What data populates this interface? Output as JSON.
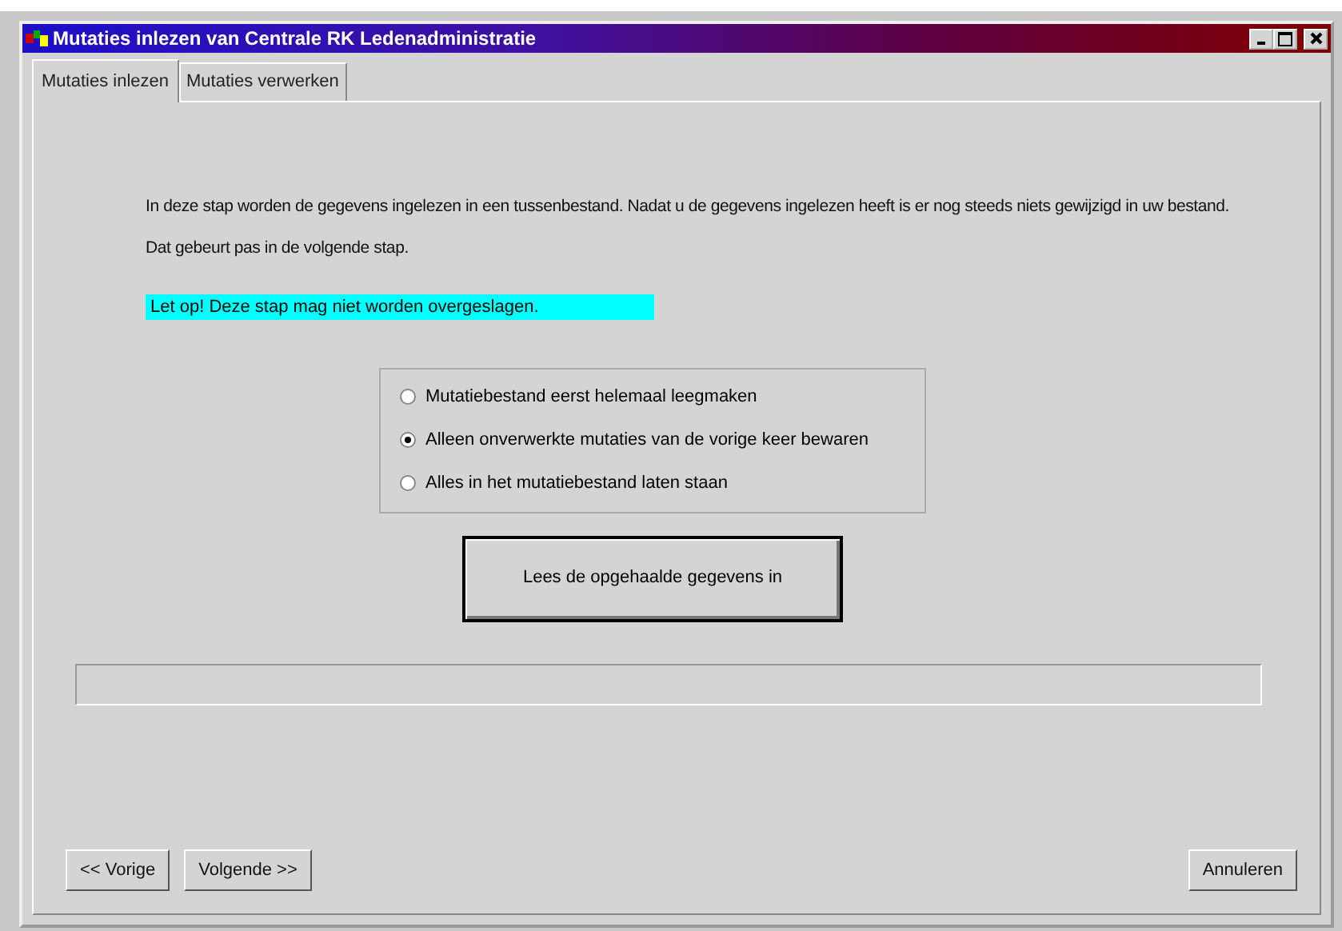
{
  "window": {
    "title": "Mutaties inlezen van Centrale RK Ledenadministratie"
  },
  "tabs": [
    {
      "label": "Mutaties inlezen",
      "selected": true
    },
    {
      "label": "Mutaties verwerken",
      "selected": false
    }
  ],
  "intro": "In deze stap worden de gegevens ingelezen in een tussenbestand. Nadat u de gegevens ingelezen heeft is er nog steeds niets gewijzigd in uw bestand. Dat gebeurt pas in de volgende stap.",
  "warning": "Let op! Deze stap mag niet worden overgeslagen.",
  "options": [
    {
      "label": "Mutatiebestand eerst helemaal leegmaken",
      "selected": false
    },
    {
      "label": "Alleen onverwerkte mutaties van de vorige keer bewaren",
      "selected": true
    },
    {
      "label": "Alles in het mutatiebestand laten staan",
      "selected": false
    }
  ],
  "action_button": "Lees de opgehaalde gegevens in",
  "buttons": {
    "previous": "<<  Vorige",
    "next": "Volgende >>",
    "cancel": "Annuleren"
  }
}
